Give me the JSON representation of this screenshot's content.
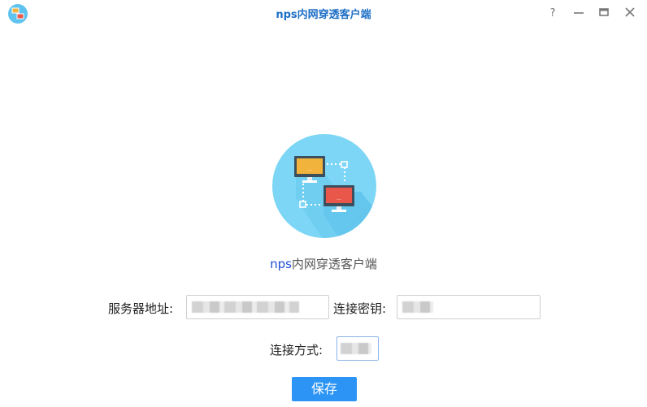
{
  "window": {
    "title": "nps内网穿透客户端"
  },
  "titlebar_buttons": {
    "help": "help-icon",
    "minimize": "minimize-icon",
    "maximize": "maximize-icon",
    "close": "close-icon"
  },
  "hero": {
    "icon": "network-computers-icon",
    "app_name_latin": "nps",
    "app_name_rest": "内网穿透客户端"
  },
  "form": {
    "server_label": "服务器地址:",
    "server_value": "",
    "key_label": "连接密钥:",
    "key_value": "",
    "type_label": "连接方式:",
    "type_value": ""
  },
  "actions": {
    "save_label": "保存"
  },
  "colors": {
    "title": "#1e6fc6",
    "accent": "#2b94f4",
    "hero_bg": "#6ecdf1",
    "monitor_yellow": "#f2b33d",
    "monitor_red": "#e9574b"
  }
}
